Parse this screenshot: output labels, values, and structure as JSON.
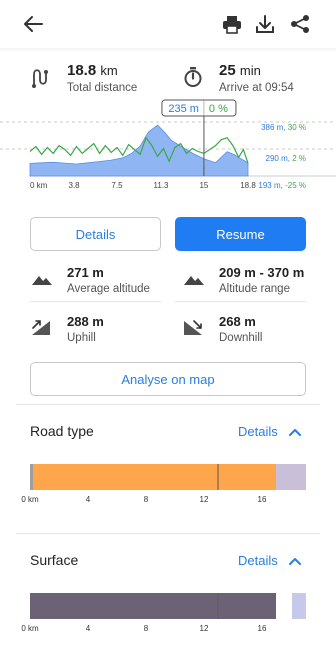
{
  "header": {
    "icons": [
      "back-arrow-icon",
      "print-icon",
      "download-icon",
      "share-icon"
    ]
  },
  "summary": {
    "distance_value": "18.8",
    "distance_unit": "km",
    "distance_label": "Total distance",
    "time_value": "25",
    "time_unit": "min",
    "time_label": "Arrive at 09:54"
  },
  "elevation_chart": {
    "cursor_altitude": "235 m",
    "cursor_slope": "0 %",
    "right_labels": [
      "386 m, 30 %",
      "290 m, 2 %",
      "193 m, -25 %"
    ],
    "x_ticks": [
      "0 km",
      "3.8",
      "7.5",
      "11.3",
      "15",
      "18.8"
    ],
    "colors": {
      "altitude_fill": "#8fb5f2",
      "slope_line": "#3aa84a",
      "cursor": "#555555"
    }
  },
  "buttons": {
    "details": "Details",
    "resume": "Resume",
    "analyse": "Analyse on map"
  },
  "altitude_stats": {
    "avg_value": "271 m",
    "avg_label": "Average altitude",
    "range_value": "209 m - 370 m",
    "range_label": "Altitude range",
    "uphill_value": "288 m",
    "uphill_label": "Uphill",
    "downhill_value": "268 m",
    "downhill_label": "Downhill"
  },
  "road_type": {
    "title": "Road type",
    "details": "Details",
    "x_ticks": [
      "0 km",
      "4",
      "8",
      "12",
      "16"
    ],
    "colors": {
      "main": "#ffa64d",
      "tail": "#c9bfd9",
      "edge": "#9e9e9e"
    }
  },
  "surface": {
    "title": "Surface",
    "details": "Details",
    "x_ticks": [
      "0 km",
      "4",
      "8",
      "12",
      "16"
    ],
    "colors": {
      "main": "#6b6276",
      "tail": "#c7c8ea"
    }
  },
  "chart_data": {
    "type": "area",
    "x_unit": "km",
    "xlim": [
      0,
      18.8
    ],
    "x_ticks": [
      0,
      3.8,
      7.5,
      11.3,
      15,
      18.8
    ],
    "ylim_altitude_m": [
      193,
      386
    ],
    "ylim_slope_pct": [
      -25,
      30
    ],
    "series": [
      {
        "name": "altitude",
        "x": [
          0,
          1,
          2,
          3,
          4,
          5,
          6,
          7,
          8,
          8.8,
          9.5,
          10.2,
          11,
          11.6,
          12.2,
          13,
          14,
          15,
          16,
          17,
          17.6,
          18.2,
          18.8
        ],
        "values": [
          238,
          240,
          242,
          239,
          236,
          240,
          245,
          250,
          258,
          275,
          300,
          350,
          375,
          350,
          320,
          300,
          275,
          255,
          240,
          280,
          270,
          255,
          240
        ]
      },
      {
        "name": "slope",
        "x": [
          0,
          0.5,
          1,
          1.5,
          2,
          2.5,
          3,
          3.5,
          4,
          4.5,
          5,
          5.5,
          6,
          6.5,
          7,
          7.5,
          8,
          8.5,
          9,
          9.5,
          10,
          10.5,
          11,
          11.5,
          12,
          12.5,
          13,
          13.5,
          14,
          14.5,
          15,
          15.5,
          16,
          16.5,
          17,
          17.5,
          18,
          18.4,
          18.8
        ],
        "values": [
          0,
          5,
          -3,
          4,
          -2,
          6,
          2,
          -4,
          5,
          -2,
          3,
          8,
          -2,
          6,
          -1,
          4,
          -4,
          7,
          2,
          -3,
          14,
          6,
          -5,
          3,
          -10,
          4,
          8,
          -2,
          3,
          0,
          -2,
          2,
          6,
          12,
          14,
          6,
          -6,
          2,
          -12
        ]
      }
    ],
    "cursor_x": 15,
    "cursor_altitude_m": 235,
    "cursor_slope_pct": 0
  }
}
